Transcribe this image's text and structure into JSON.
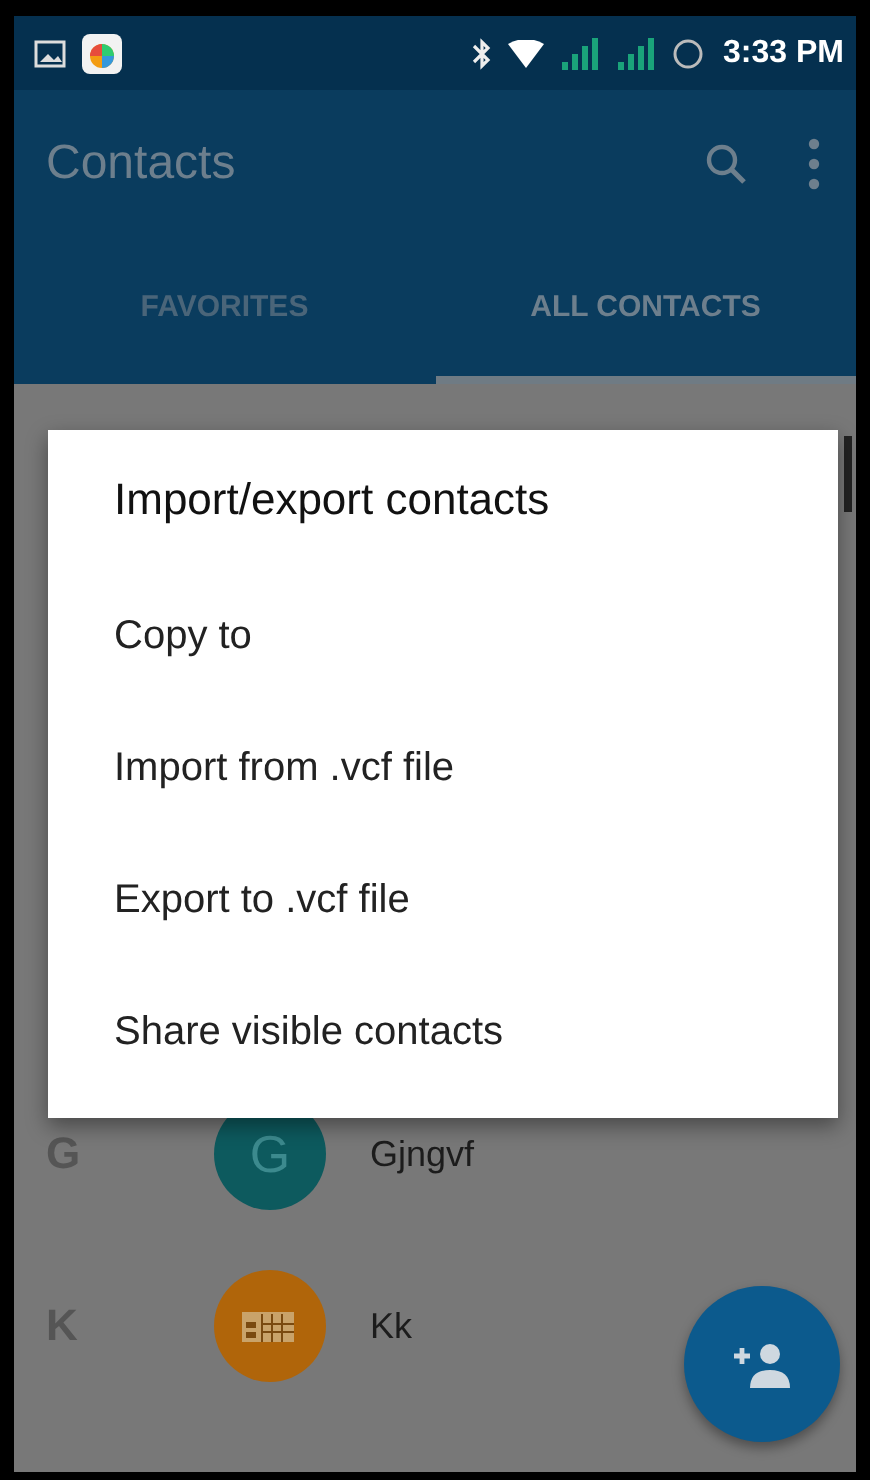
{
  "status_bar": {
    "time": "3:33 PM"
  },
  "app_bar": {
    "title": "Contacts"
  },
  "tabs": [
    {
      "label": "FAVORITES",
      "selected": false
    },
    {
      "label": "ALL CONTACTS",
      "selected": true
    }
  ],
  "contacts": [
    {
      "section": "G",
      "name": "Gjngvf",
      "initial": "G",
      "kind": "letter",
      "color": "#0d5a5e"
    },
    {
      "section": "K",
      "name": "Kk",
      "kind": "sim",
      "color": "#b0650a"
    }
  ],
  "dialog": {
    "title": "Import/export contacts",
    "items": [
      "Copy to",
      "Import from .vcf file",
      "Export to .vcf file",
      "Share visible contacts"
    ]
  }
}
